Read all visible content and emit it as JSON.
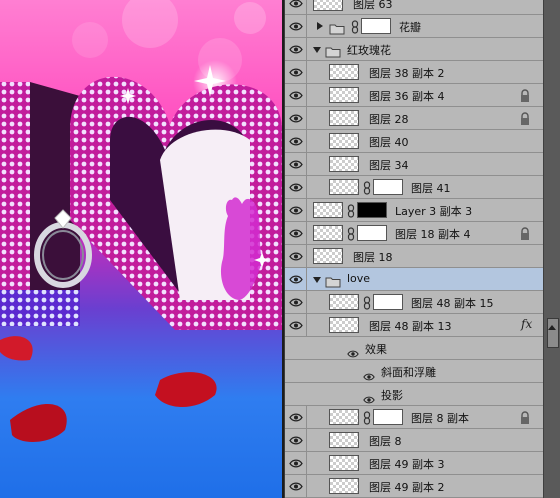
{
  "document_canvas": {
    "description_colors": {
      "pink": "#ff4fc0",
      "magenta": "#d22bb8",
      "blue": "#1f6fe8"
    }
  },
  "layers_panel": {
    "rows": [
      {
        "name": "图层 63",
        "kind": "layer",
        "partial": true
      },
      {
        "name": "花瓣",
        "kind": "group",
        "expanded": false,
        "mask": true
      },
      {
        "name": "红玫瑰花",
        "kind": "group",
        "expanded": true
      },
      {
        "name": "图层 38 副本 2",
        "kind": "layer",
        "indent": true
      },
      {
        "name": "图层 36 副本 4",
        "kind": "layer",
        "indent": true,
        "locked": true
      },
      {
        "name": "图层 28",
        "kind": "layer",
        "indent": true,
        "locked": true
      },
      {
        "name": "图层 40",
        "kind": "layer",
        "indent": true
      },
      {
        "name": "图层 34",
        "kind": "layer",
        "indent": true
      },
      {
        "name": "图层 41",
        "kind": "layer",
        "indent": true,
        "mask": true
      },
      {
        "name": "Layer 3 副本 3",
        "kind": "layer",
        "mask": true,
        "mask_black": true
      },
      {
        "name": "图层 18 副本 4",
        "kind": "layer",
        "mask": true,
        "locked": true
      },
      {
        "name": "图层 18",
        "kind": "layer"
      },
      {
        "name": "love",
        "kind": "group",
        "expanded": true,
        "selected": true
      },
      {
        "name": "图层 48 副本 15",
        "kind": "layer",
        "indent": true,
        "mask": true
      },
      {
        "name": "图层 48 副本 13",
        "kind": "layer",
        "indent": true,
        "fx": true
      },
      {
        "name": "效果",
        "kind": "effect-header"
      },
      {
        "name": "斜面和浮雕",
        "kind": "effect"
      },
      {
        "name": "投影",
        "kind": "effect"
      },
      {
        "name": "图层 8 副本",
        "kind": "layer",
        "indent": true,
        "mask": true,
        "locked": true
      },
      {
        "name": "图层 8",
        "kind": "layer",
        "indent": true
      },
      {
        "name": "图层 49 副本 3",
        "kind": "layer",
        "indent": true
      },
      {
        "name": "图层 49 副本 2",
        "kind": "layer",
        "indent": true
      }
    ],
    "fx_label": "fx"
  }
}
